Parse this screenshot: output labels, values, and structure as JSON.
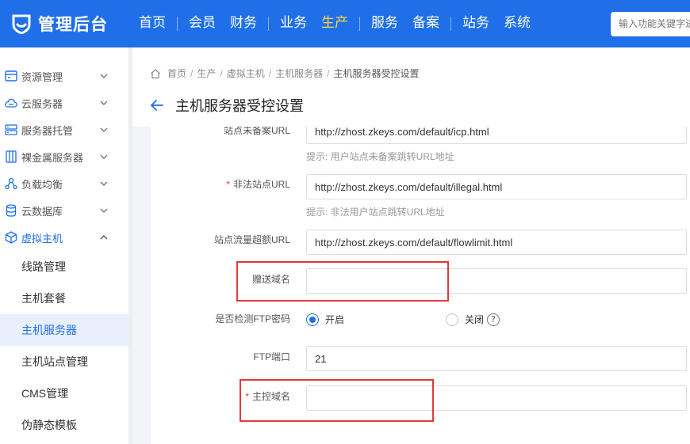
{
  "brand": {
    "name": "管理后台"
  },
  "nav": {
    "items": [
      {
        "label": "首页"
      },
      {
        "label": "会员"
      },
      {
        "label": "财务"
      },
      {
        "label": "业务"
      },
      {
        "label": "生产"
      },
      {
        "label": "服务"
      },
      {
        "label": "备案"
      },
      {
        "label": "站务"
      },
      {
        "label": "系统"
      }
    ],
    "active": "生产",
    "search_placeholder": "输入功能关键字进行搜索"
  },
  "sidebar": {
    "items": [
      {
        "label": "资源管理",
        "icon": "server-rack-icon"
      },
      {
        "label": "云服务器",
        "icon": "cloud-icon"
      },
      {
        "label": "服务器托管",
        "icon": "hosting-icon"
      },
      {
        "label": "裸金属服务器",
        "icon": "bare-metal-icon"
      },
      {
        "label": "负载均衡",
        "icon": "load-balance-icon"
      },
      {
        "label": "云数据库",
        "icon": "database-icon"
      },
      {
        "label": "虚拟主机",
        "icon": "cube-icon"
      }
    ],
    "sub_items": [
      {
        "label": "线路管理"
      },
      {
        "label": "主机套餐"
      },
      {
        "label": "主机服务器"
      },
      {
        "label": "主机站点管理"
      },
      {
        "label": "CMS管理"
      },
      {
        "label": "伪静态模板"
      }
    ],
    "active_sub": "主机服务器"
  },
  "breadcrumb": {
    "items": [
      "首页",
      "生产",
      "虚拟主机",
      "主机服务器",
      "主机服务器受控设置"
    ]
  },
  "page": {
    "title": "主机服务器受控设置"
  },
  "form": {
    "icp_url": {
      "label": "站点未备案URL",
      "value": "http://zhost.zkeys.com/default/icp.html",
      "hint": "提示: 用户站点未备案跳转URL地址"
    },
    "illegal_url": {
      "label": "非法站点URL",
      "required": "*",
      "value": "http://zhost.zkeys.com/default/illegal.html",
      "hint": "提示: 非法用户站点跳转URL地址"
    },
    "flowlimit_url": {
      "label": "站点流量超额URL",
      "value": "http://zhost.zkeys.com/default/flowlimit.html"
    },
    "gift_domain": {
      "label": "赠送域名",
      "value": ""
    },
    "ftp_check": {
      "label": "是否检测FTP密码",
      "on_label": "开启",
      "off_label": "关闭",
      "help": "?",
      "selected": "开启"
    },
    "ftp_port": {
      "label": "FTP端口",
      "value": "21"
    },
    "master_domain": {
      "label": "主控域名",
      "required": "*",
      "value": ""
    }
  },
  "colors": {
    "primary": "#1f6fe8",
    "active_nav": "#ffd54a",
    "highlight_box": "#e03a3a",
    "required": "#e23b3b"
  }
}
